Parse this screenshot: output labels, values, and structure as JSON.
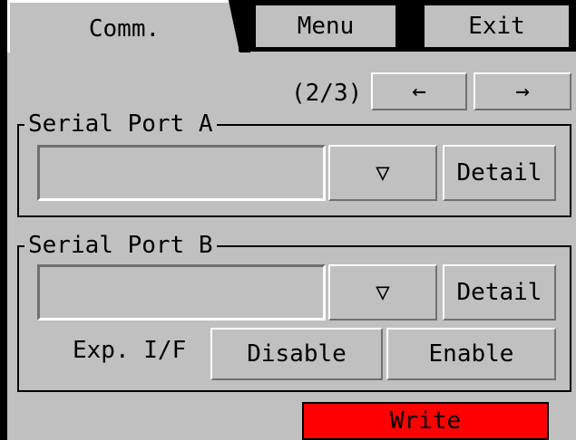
{
  "tabs": {
    "active_label": "Comm."
  },
  "top_buttons": {
    "menu": "Menu",
    "exit": "Exit"
  },
  "pager": {
    "page": "(2/3)",
    "prev": "←",
    "next": "→"
  },
  "port_a": {
    "title": "Serial Port A",
    "value": "",
    "dropdown": "▽",
    "detail": "Detail"
  },
  "port_b": {
    "title": "Serial Port B",
    "value": "",
    "dropdown": "▽",
    "detail": "Detail"
  },
  "exp_if": {
    "label": "Exp. I/F",
    "disable": "Disable",
    "enable": "Enable"
  },
  "footer": {
    "write": "Write",
    "write_color": "#ff0000"
  }
}
